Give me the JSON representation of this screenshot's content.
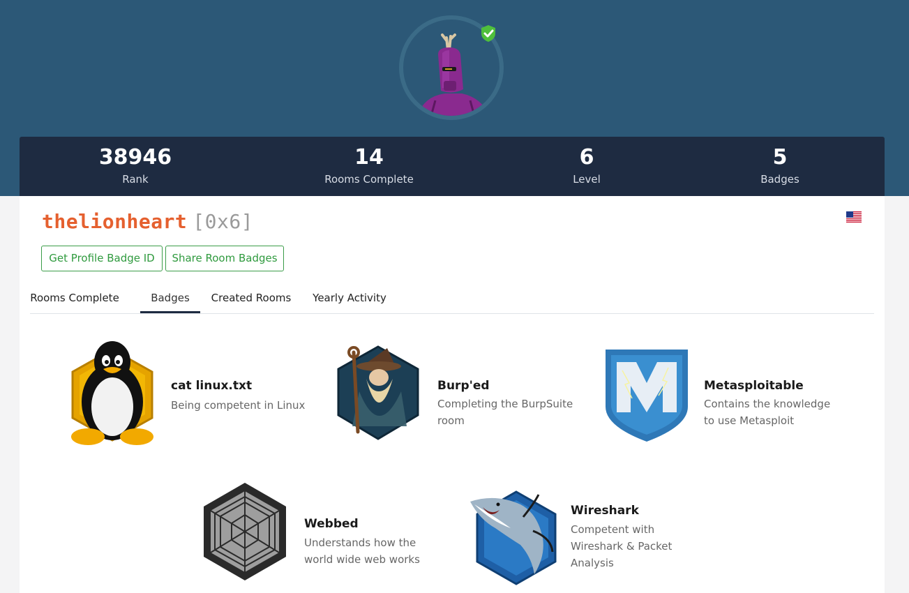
{
  "profile": {
    "username": "thelionheart",
    "level_code": "[0x6]",
    "avatar": "robot-avatar",
    "verified_icon": "verified-shield-icon",
    "flag_icon": "us-flag-icon"
  },
  "stats": [
    {
      "value": "38946",
      "label": "Rank"
    },
    {
      "value": "14",
      "label": "Rooms Complete"
    },
    {
      "value": "6",
      "label": "Level"
    },
    {
      "value": "5",
      "label": "Badges"
    }
  ],
  "buttons": {
    "profile_badge": "Get Profile Badge ID",
    "share_badges": "Share Room Badges"
  },
  "tabs": [
    "Rooms Complete",
    "Badges",
    "Created Rooms",
    "Yearly Activity"
  ],
  "active_tab": "Badges",
  "badges": [
    {
      "title": "cat linux.txt",
      "desc_lines": [
        "Being competent in Linux"
      ],
      "icon": "penguin-badge-icon"
    },
    {
      "title": "Burp'ed",
      "desc_lines": [
        "Completing the BurpSuite",
        "room"
      ],
      "icon": "wizard-badge-icon"
    },
    {
      "title": "Metasploitable",
      "desc_lines": [
        "Contains the knowledge",
        "to use Metasploit"
      ],
      "icon": "metasploit-badge-icon"
    },
    {
      "title": "Webbed",
      "desc_lines": [
        "Understands how the",
        "world wide web works"
      ],
      "icon": "spiderweb-badge-icon"
    },
    {
      "title": "Wireshark",
      "desc_lines": [
        "Competent with",
        "Wireshark & Packet",
        "Analysis"
      ],
      "icon": "shark-badge-icon"
    }
  ],
  "colors": {
    "hero": "#2c5877",
    "stats_bar": "#1e2b41",
    "username": "#e5602f",
    "button_green": "#3a9c48"
  }
}
